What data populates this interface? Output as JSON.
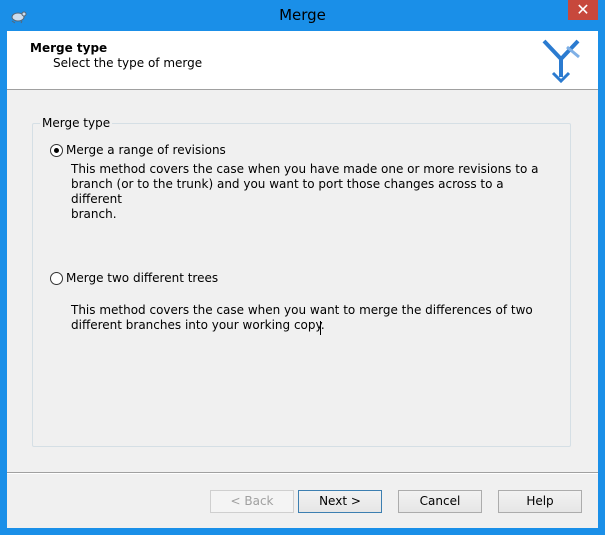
{
  "window": {
    "title": "Merge",
    "close_glyph": "✕"
  },
  "header": {
    "title": "Merge type",
    "subtitle": "Select the type of merge"
  },
  "group": {
    "legend": "Merge type"
  },
  "options": [
    {
      "label": "Merge a range of revisions",
      "selected": true,
      "desc_lines": [
        "This method covers the case when you have made one or more revisions to a",
        "branch (or to the trunk) and you want to port those changes across to a different",
        "branch."
      ]
    },
    {
      "label": "Merge two different trees",
      "selected": false,
      "desc_lines": [
        "This method covers the case when you want to merge the differences of two",
        "different branches into your working copy."
      ]
    }
  ],
  "buttons": {
    "back": "< Back",
    "next": "Next >",
    "cancel": "Cancel",
    "help": "Help"
  },
  "colors": {
    "titlebar": "#1a8fe8",
    "close": "#c7483c",
    "logo": "#2b7bd0"
  },
  "icons": {
    "app": "tortoise-icon",
    "logo": "merge-logo-icon"
  }
}
